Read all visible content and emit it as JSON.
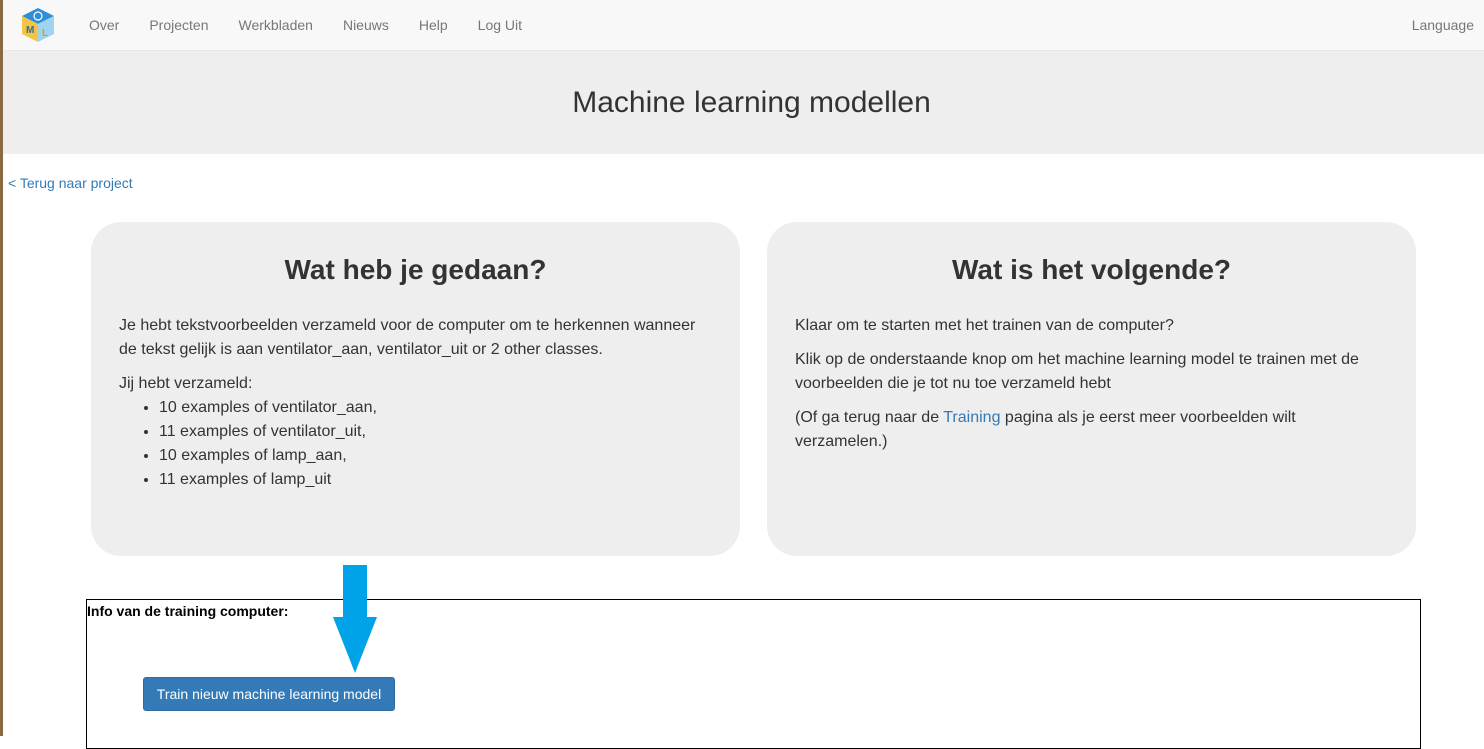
{
  "nav": {
    "links": [
      "Over",
      "Projecten",
      "Werkbladen",
      "Nieuws",
      "Help",
      "Log Uit"
    ],
    "language_label": "Language",
    "logo_letters": [
      "M",
      "L"
    ]
  },
  "page_title": "Machine learning modellen",
  "back_link": "< Terug naar project",
  "left_panel": {
    "heading": "Wat heb je gedaan?",
    "intro": "Je hebt tekstvoorbeelden verzameld voor de computer om te herkennen wanneer de tekst gelijk is aan ventilator_aan, ventilator_uit or 2 other classes.",
    "collected_label": "Jij hebt verzameld:",
    "items": [
      "10 examples of ventilator_aan,",
      "11 examples of ventilator_uit,",
      "10 examples of lamp_aan,",
      "11 examples of lamp_uit"
    ]
  },
  "right_panel": {
    "heading": "Wat is het volgende?",
    "p1": "Klaar om te starten met het trainen van de computer?",
    "p2": "Klik op de onderstaande knop om het machine learning model te trainen met de voorbeelden die je tot nu toe verzameld hebt",
    "p3_prefix": "(Of ga terug naar de ",
    "p3_link": "Training",
    "p3_suffix": " pagina als je eerst meer voorbeelden wilt verzamelen.)"
  },
  "info_box": {
    "title": "Info van de training computer:",
    "train_button": "Train nieuw machine learning model"
  },
  "colors": {
    "primary": "#337ab7",
    "arrow": "#00a2e8",
    "panel_bg": "#eeeeee"
  },
  "icons": {
    "logo": "ml-cube-logo-icon",
    "arrow": "down-arrow-icon"
  }
}
